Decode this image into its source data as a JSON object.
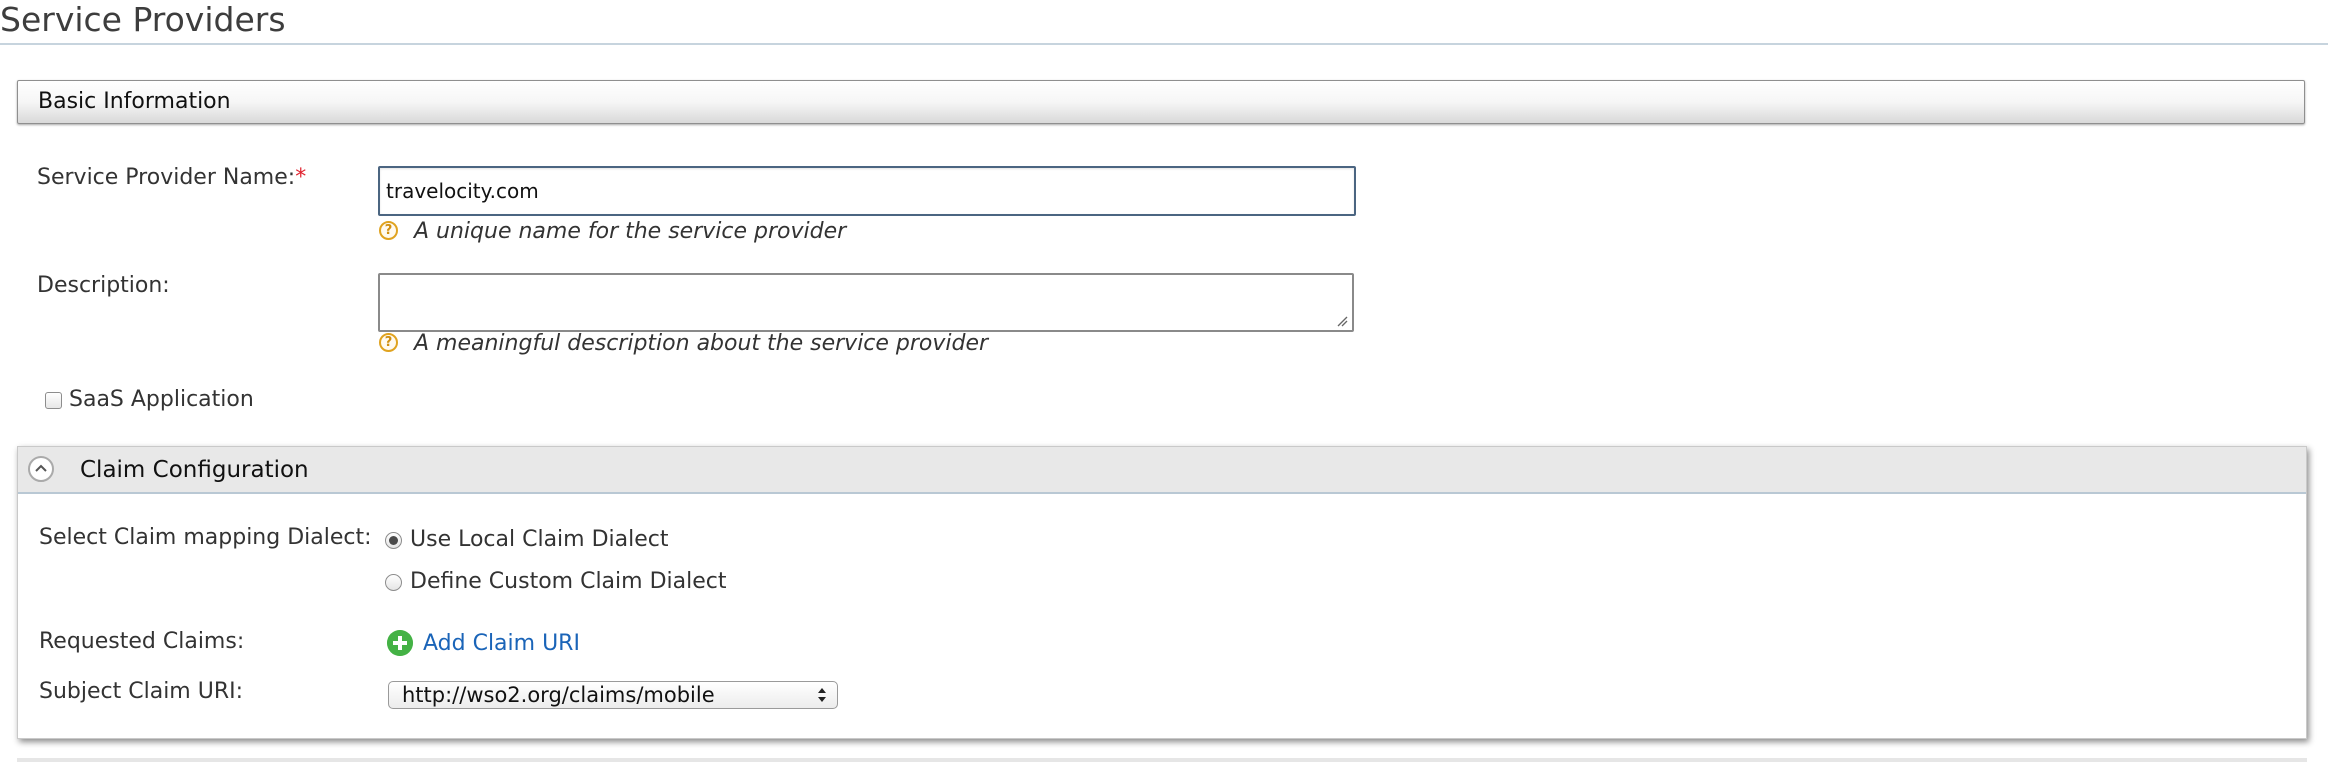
{
  "page": {
    "title": "Service Providers"
  },
  "basic_info": {
    "section_title": "Basic Information",
    "name_label": "Service Provider Name:",
    "required_mark": "*",
    "name_value": "travelocity.com",
    "name_help": "A unique name for the service provider",
    "description_label": "Description:",
    "description_value": "",
    "description_help": "A meaningful description about the service provider",
    "saas_label": "SaaS Application",
    "saas_checked": false,
    "help_glyph": "?"
  },
  "claim_config": {
    "section_title": "Claim Configuration",
    "dialect_label": "Select Claim mapping Dialect:",
    "dialect_options": [
      {
        "label": "Use Local Claim Dialect",
        "checked": true
      },
      {
        "label": "Define Custom Claim Dialect",
        "checked": false
      }
    ],
    "requested_label": "Requested Claims:",
    "add_claim_label": "Add Claim URI",
    "subject_label": "Subject Claim URI:",
    "subject_value": "http://wso2.org/claims/mobile"
  },
  "icons": {
    "help": "question-circle-icon",
    "collapse": "chevron-up-icon",
    "add": "plus-circle-icon",
    "select": "updown-arrows-icon"
  },
  "colors": {
    "required": "#e0222e",
    "link": "#1a64b8",
    "add_icon": "#44b245",
    "help_icon": "#e0a320",
    "input_border": "#4b6581"
  }
}
